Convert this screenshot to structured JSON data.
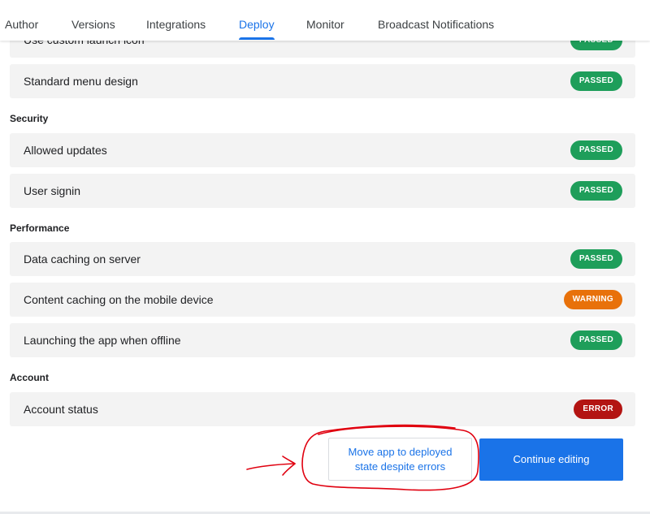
{
  "tabs": [
    {
      "label": "Author"
    },
    {
      "label": "Versions"
    },
    {
      "label": "Integrations"
    },
    {
      "label": "Deploy",
      "active": true
    },
    {
      "label": "Monitor"
    },
    {
      "label": "Broadcast Notifications"
    }
  ],
  "rows": {
    "partial": {
      "label": "Use custom launch icon",
      "status": "PASSED"
    },
    "menu": {
      "label": "Standard menu design",
      "status": "PASSED"
    },
    "security_title": "Security",
    "allowed_updates": {
      "label": "Allowed updates",
      "status": "PASSED"
    },
    "user_signin": {
      "label": "User signin",
      "status": "PASSED"
    },
    "performance_title": "Performance",
    "data_caching": {
      "label": "Data caching on server",
      "status": "PASSED"
    },
    "content_caching": {
      "label": "Content caching on the mobile device",
      "status": "WARNING"
    },
    "offline": {
      "label": "Launching the app when offline",
      "status": "PASSED"
    },
    "account_title": "Account",
    "account_status": {
      "label": "Account status",
      "status": "ERROR"
    }
  },
  "buttons": {
    "move_line1": "Move app to deployed",
    "move_line2": "state despite errors",
    "continue": "Continue editing"
  },
  "colors": {
    "accent": "#1a73e8",
    "passed": "#1e9e5a",
    "warning": "#e8710a",
    "error": "#b31412",
    "annotation": "#e0000f"
  }
}
